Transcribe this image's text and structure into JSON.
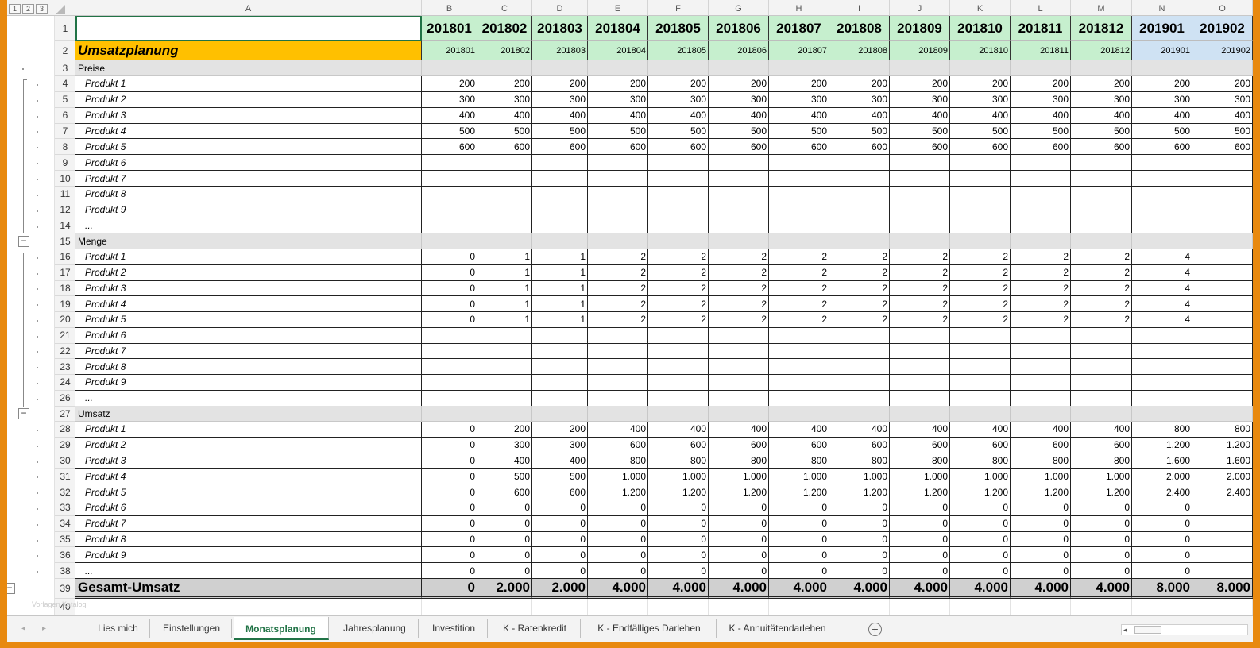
{
  "outline_levels": [
    "1",
    "2",
    "3"
  ],
  "columns": [
    "A",
    "B",
    "C",
    "D",
    "E",
    "F",
    "G",
    "H",
    "I",
    "J",
    "K",
    "L",
    "M",
    "N",
    "O"
  ],
  "header_row1": [
    "",
    "201801",
    "201802",
    "201803",
    "201804",
    "201805",
    "201806",
    "201807",
    "201808",
    "201809",
    "201810",
    "201811",
    "201812",
    "201901",
    "201902"
  ],
  "header_row2": [
    "Umsatzplanung",
    "201801",
    "201802",
    "201803",
    "201804",
    "201805",
    "201806",
    "201807",
    "201808",
    "201809",
    "201810",
    "201811",
    "201812",
    "201901",
    "201902"
  ],
  "sections": {
    "preise": {
      "label": "Preise"
    },
    "menge": {
      "label": "Menge"
    },
    "umsatz": {
      "label": "Umsatz"
    }
  },
  "preise_rows": [
    {
      "rownum": "4",
      "label": "Produkt 1",
      "values": [
        "200",
        "200",
        "200",
        "200",
        "200",
        "200",
        "200",
        "200",
        "200",
        "200",
        "200",
        "200",
        "200",
        "200"
      ]
    },
    {
      "rownum": "5",
      "label": "Produkt 2",
      "values": [
        "300",
        "300",
        "300",
        "300",
        "300",
        "300",
        "300",
        "300",
        "300",
        "300",
        "300",
        "300",
        "300",
        "300"
      ]
    },
    {
      "rownum": "6",
      "label": "Produkt 3",
      "values": [
        "400",
        "400",
        "400",
        "400",
        "400",
        "400",
        "400",
        "400",
        "400",
        "400",
        "400",
        "400",
        "400",
        "400"
      ]
    },
    {
      "rownum": "7",
      "label": "Produkt 4",
      "values": [
        "500",
        "500",
        "500",
        "500",
        "500",
        "500",
        "500",
        "500",
        "500",
        "500",
        "500",
        "500",
        "500",
        "500"
      ]
    },
    {
      "rownum": "8",
      "label": "Produkt 5",
      "values": [
        "600",
        "600",
        "600",
        "600",
        "600",
        "600",
        "600",
        "600",
        "600",
        "600",
        "600",
        "600",
        "600",
        "600"
      ]
    },
    {
      "rownum": "9",
      "label": "Produkt 6",
      "values": [
        "",
        "",
        "",
        "",
        "",
        "",
        "",
        "",
        "",
        "",
        "",
        "",
        "",
        ""
      ]
    },
    {
      "rownum": "10",
      "label": "Produkt 7",
      "values": [
        "",
        "",
        "",
        "",
        "",
        "",
        "",
        "",
        "",
        "",
        "",
        "",
        "",
        ""
      ]
    },
    {
      "rownum": "11",
      "label": "Produkt 8",
      "values": [
        "",
        "",
        "",
        "",
        "",
        "",
        "",
        "",
        "",
        "",
        "",
        "",
        "",
        ""
      ]
    },
    {
      "rownum": "12",
      "label": "Produkt 9",
      "values": [
        "",
        "",
        "",
        "",
        "",
        "",
        "",
        "",
        "",
        "",
        "",
        "",
        "",
        ""
      ]
    },
    {
      "rownum": "14",
      "label": "...",
      "values": [
        "",
        "",
        "",
        "",
        "",
        "",
        "",
        "",
        "",
        "",
        "",
        "",
        "",
        ""
      ]
    }
  ],
  "menge_rows": [
    {
      "rownum": "16",
      "label": "Produkt 1",
      "values": [
        "0",
        "1",
        "1",
        "2",
        "2",
        "2",
        "2",
        "2",
        "2",
        "2",
        "2",
        "2",
        "4",
        ""
      ]
    },
    {
      "rownum": "17",
      "label": "Produkt 2",
      "values": [
        "0",
        "1",
        "1",
        "2",
        "2",
        "2",
        "2",
        "2",
        "2",
        "2",
        "2",
        "2",
        "4",
        ""
      ]
    },
    {
      "rownum": "18",
      "label": "Produkt 3",
      "values": [
        "0",
        "1",
        "1",
        "2",
        "2",
        "2",
        "2",
        "2",
        "2",
        "2",
        "2",
        "2",
        "4",
        ""
      ]
    },
    {
      "rownum": "19",
      "label": "Produkt 4",
      "values": [
        "0",
        "1",
        "1",
        "2",
        "2",
        "2",
        "2",
        "2",
        "2",
        "2",
        "2",
        "2",
        "4",
        ""
      ]
    },
    {
      "rownum": "20",
      "label": "Produkt 5",
      "values": [
        "0",
        "1",
        "1",
        "2",
        "2",
        "2",
        "2",
        "2",
        "2",
        "2",
        "2",
        "2",
        "4",
        ""
      ]
    },
    {
      "rownum": "21",
      "label": "Produkt 6",
      "values": [
        "",
        "",
        "",
        "",
        "",
        "",
        "",
        "",
        "",
        "",
        "",
        "",
        "",
        ""
      ]
    },
    {
      "rownum": "22",
      "label": "Produkt 7",
      "values": [
        "",
        "",
        "",
        "",
        "",
        "",
        "",
        "",
        "",
        "",
        "",
        "",
        "",
        ""
      ]
    },
    {
      "rownum": "23",
      "label": "Produkt 8",
      "values": [
        "",
        "",
        "",
        "",
        "",
        "",
        "",
        "",
        "",
        "",
        "",
        "",
        "",
        ""
      ]
    },
    {
      "rownum": "24",
      "label": "Produkt 9",
      "values": [
        "",
        "",
        "",
        "",
        "",
        "",
        "",
        "",
        "",
        "",
        "",
        "",
        "",
        ""
      ]
    },
    {
      "rownum": "26",
      "label": "...",
      "values": [
        "",
        "",
        "",
        "",
        "",
        "",
        "",
        "",
        "",
        "",
        "",
        "",
        "",
        ""
      ]
    }
  ],
  "umsatz_rows": [
    {
      "rownum": "28",
      "label": "Produkt 1",
      "values": [
        "0",
        "200",
        "200",
        "400",
        "400",
        "400",
        "400",
        "400",
        "400",
        "400",
        "400",
        "400",
        "800",
        "800"
      ]
    },
    {
      "rownum": "29",
      "label": "Produkt 2",
      "values": [
        "0",
        "300",
        "300",
        "600",
        "600",
        "600",
        "600",
        "600",
        "600",
        "600",
        "600",
        "600",
        "1.200",
        "1.200"
      ]
    },
    {
      "rownum": "30",
      "label": "Produkt 3",
      "values": [
        "0",
        "400",
        "400",
        "800",
        "800",
        "800",
        "800",
        "800",
        "800",
        "800",
        "800",
        "800",
        "1.600",
        "1.600"
      ]
    },
    {
      "rownum": "31",
      "label": "Produkt 4",
      "values": [
        "0",
        "500",
        "500",
        "1.000",
        "1.000",
        "1.000",
        "1.000",
        "1.000",
        "1.000",
        "1.000",
        "1.000",
        "1.000",
        "2.000",
        "2.000"
      ]
    },
    {
      "rownum": "32",
      "label": "Produkt 5",
      "values": [
        "0",
        "600",
        "600",
        "1.200",
        "1.200",
        "1.200",
        "1.200",
        "1.200",
        "1.200",
        "1.200",
        "1.200",
        "1.200",
        "2.400",
        "2.400"
      ]
    },
    {
      "rownum": "33",
      "label": "Produkt 6",
      "values": [
        "0",
        "0",
        "0",
        "0",
        "0",
        "0",
        "0",
        "0",
        "0",
        "0",
        "0",
        "0",
        "0",
        ""
      ]
    },
    {
      "rownum": "34",
      "label": "Produkt 7",
      "values": [
        "0",
        "0",
        "0",
        "0",
        "0",
        "0",
        "0",
        "0",
        "0",
        "0",
        "0",
        "0",
        "0",
        ""
      ]
    },
    {
      "rownum": "35",
      "label": "Produkt 8",
      "values": [
        "0",
        "0",
        "0",
        "0",
        "0",
        "0",
        "0",
        "0",
        "0",
        "0",
        "0",
        "0",
        "0",
        ""
      ]
    },
    {
      "rownum": "36",
      "label": "Produkt 9",
      "values": [
        "0",
        "0",
        "0",
        "0",
        "0",
        "0",
        "0",
        "0",
        "0",
        "0",
        "0",
        "0",
        "0",
        ""
      ]
    },
    {
      "rownum": "38",
      "label": "...",
      "values": [
        "0",
        "0",
        "0",
        "0",
        "0",
        "0",
        "0",
        "0",
        "0",
        "0",
        "0",
        "0",
        "0",
        ""
      ]
    }
  ],
  "total": {
    "rownum": "39",
    "label": "Gesamt-Umsatz",
    "values": [
      "0",
      "2.000",
      "2.000",
      "4.000",
      "4.000",
      "4.000",
      "4.000",
      "4.000",
      "4.000",
      "4.000",
      "4.000",
      "4.000",
      "8.000",
      "8.000"
    ]
  },
  "blank_row": {
    "rownum": "40"
  },
  "sheet_tabs": [
    "Lies mich",
    "Einstellungen",
    "Monatsplanung",
    "Jahresplanung",
    "Investition",
    "K - Ratenkredit",
    "K - Endfälliges Darlehen",
    "K - Annuitätendarlehen"
  ],
  "active_tab": "Monatsplanung",
  "watermark": "Vorlagen Katalog",
  "colors": {
    "frame": "#e8890f",
    "header_green": "#c6efce",
    "header_blue": "#cfe2f3",
    "title_fill": "#ffc000",
    "active_tab": "#217346"
  }
}
